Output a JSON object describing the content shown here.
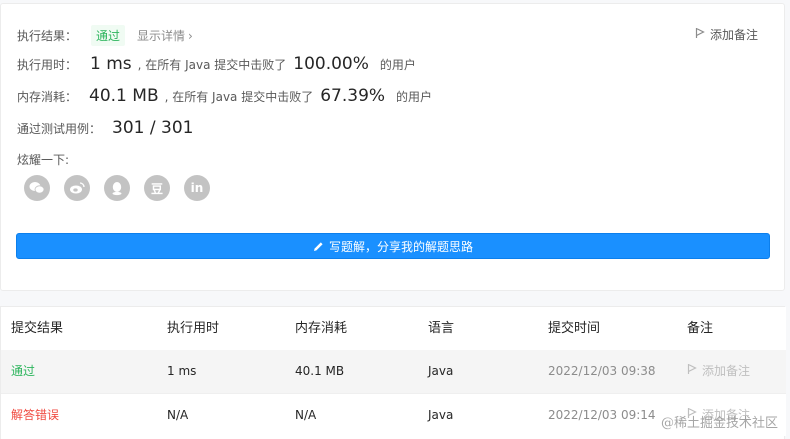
{
  "result": {
    "label": "执行结果：",
    "status": "通过",
    "detail_link": "显示详情",
    "add_note": "添加备注"
  },
  "runtime": {
    "label": "执行用时：",
    "value": "1 ms",
    "beat_prefix": ", 在所有 Java 提交中击败了",
    "percent": "100.00%",
    "suffix": "的用户"
  },
  "memory": {
    "label": "内存消耗：",
    "value": "40.1 MB",
    "beat_prefix": ", 在所有 Java 提交中击败了",
    "percent": "67.39%",
    "suffix": "的用户"
  },
  "tests": {
    "label": "通过测试用例：",
    "value": "301 / 301"
  },
  "share": {
    "label": "炫耀一下:",
    "icons": [
      "wechat-icon",
      "weibo-icon",
      "qq-icon",
      "douban-icon",
      "linkedin-icon"
    ],
    "douban_text": "豆",
    "linkedin_text": "in"
  },
  "write_solution": "写题解，分享我的解题思路",
  "table": {
    "headers": [
      "提交结果",
      "执行用时",
      "内存消耗",
      "语言",
      "提交时间",
      "备注"
    ],
    "rows": [
      {
        "status": "通过",
        "runtime": "1 ms",
        "memory": "40.1 MB",
        "lang": "Java",
        "time": "2022/12/03 09:38",
        "note": "添加备注"
      },
      {
        "status": "解答错误",
        "runtime": "N/A",
        "memory": "N/A",
        "lang": "Java",
        "time": "2022/12/03 09:14",
        "note": "添加备注"
      }
    ]
  },
  "watermark": "@稀土掘金技术社区",
  "colors": {
    "pass": "#2db55d",
    "fail": "#f04a40",
    "accent": "#1a90ff"
  }
}
